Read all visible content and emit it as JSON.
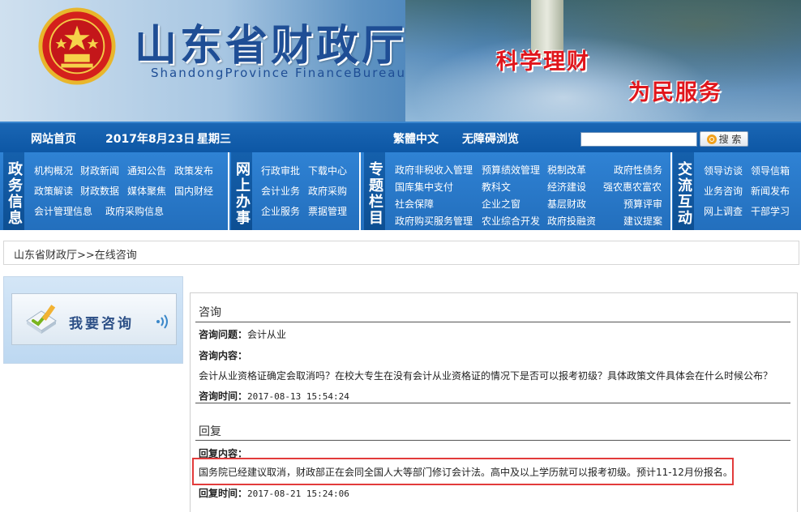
{
  "banner": {
    "site_title": "山东省财政厅",
    "site_en": "ShandongProvince FinanceBureau",
    "slogan_1": "科学理财",
    "slogan_2": "为民服务"
  },
  "topbar": {
    "home": "网站首页",
    "date": "2017年8月23日",
    "weekday": "星期三",
    "traditional": "繁體中文",
    "accessible": "无障碍浏览",
    "search_placeholder": "",
    "search_label": "搜 索"
  },
  "nav": {
    "groups": [
      {
        "head": "政务信息",
        "links": [
          "机构概况",
          "财政新闻",
          "通知公告",
          "政策发布",
          "政策解读",
          "财政数据",
          "媒体聚焦",
          "国内财经",
          "会计管理信息",
          "政府采购信息"
        ]
      },
      {
        "head": "网上办事",
        "links": [
          "行政审批",
          "下载中心",
          "会计业务",
          "政府采购",
          "企业服务",
          "票据管理"
        ]
      },
      {
        "head": "专题栏目",
        "links": [
          "政府非税收入管理",
          "预算绩效管理",
          "税制改革",
          "政府性债务",
          "国库集中支付",
          "教科文",
          "经济建设",
          "强农惠农富农",
          "社会保障",
          "企业之窗",
          "基层财政",
          "预算评审",
          "政府购买服务管理",
          "农业综合开发",
          "政府投融资",
          "建议提案"
        ]
      },
      {
        "head": "交流互动",
        "links": [
          "领导访谈",
          "领导信箱",
          "业务咨询",
          "新闻发布",
          "网上调查",
          "干部学习"
        ]
      }
    ]
  },
  "breadcrumb": "山东省财政厅>>在线咨询",
  "left": {
    "ask_label": "我要咨询"
  },
  "consult": {
    "section_title": "咨询",
    "question_label": "咨询问题：",
    "question_value": "会计从业",
    "content_label": "咨询内容：",
    "content_text": "会计从业资格证确定会取消吗？在校大专生在没有会计从业资格证的情况下是否可以报考初级？具体政策文件具体会在什么时候公布？",
    "time_label": "咨询时间：",
    "time_value": "2017-08-13 15:54:24"
  },
  "reply": {
    "section_title": "回复",
    "content_label": "回复内容：",
    "content_text": "国务院已经建议取消，财政部正在会同全国人大等部门修订会计法。高中及以上学历就可以报考初级。预计11-12月份报名。",
    "time_label": "回复时间：",
    "time_value": "2017-08-21 15:24:06"
  },
  "colors": {
    "nav_blue": "#236fbd",
    "topbar_blue": "#0d57a5",
    "title_blue": "#1f4e95",
    "slogan_red": "#e0161c",
    "highlight_red": "#e23b3b"
  }
}
